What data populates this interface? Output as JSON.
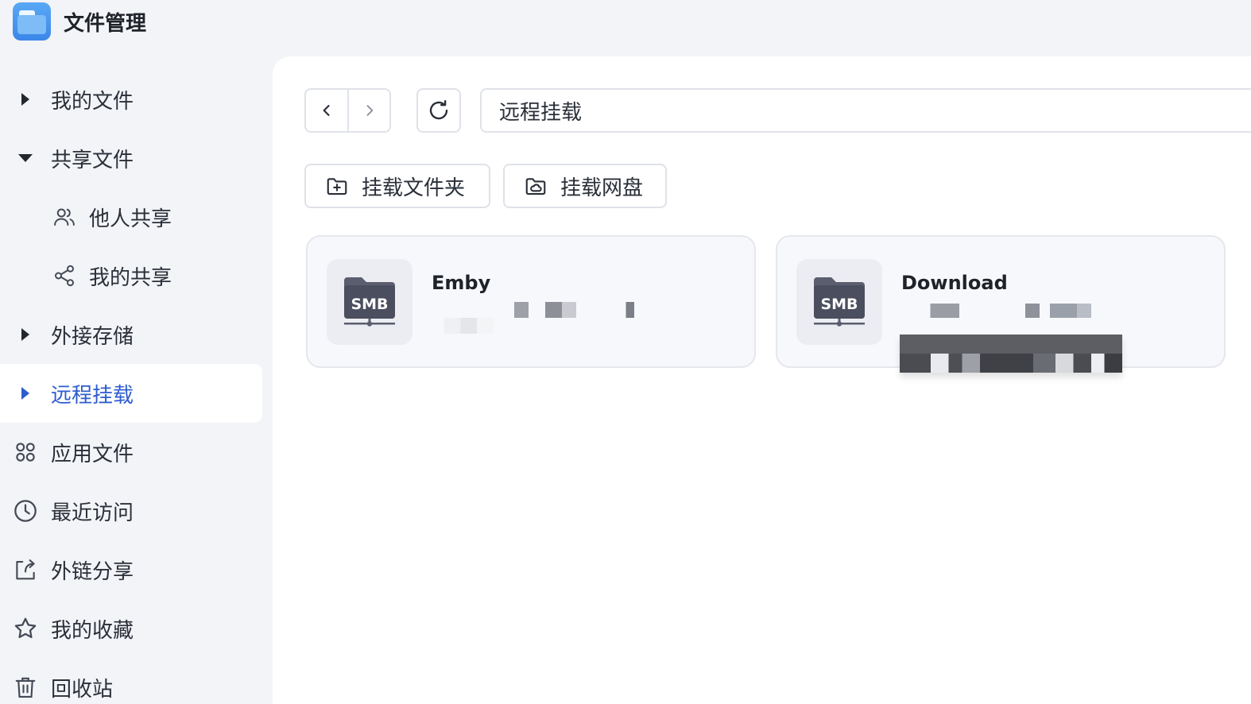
{
  "app": {
    "title": "文件管理"
  },
  "sidebar": {
    "items": [
      {
        "label": "我的文件"
      },
      {
        "label": "共享文件"
      },
      {
        "label": "他人共享"
      },
      {
        "label": "我的共享"
      },
      {
        "label": "外接存储"
      },
      {
        "label": "远程挂载",
        "active": true
      },
      {
        "label": "应用文件"
      },
      {
        "label": "最近访问"
      },
      {
        "label": "外链分享"
      },
      {
        "label": "我的收藏"
      },
      {
        "label": "回收站"
      }
    ]
  },
  "toolbar": {
    "path": "远程挂载",
    "mount_folder_label": "挂载文件夹",
    "mount_cloud_label": "挂载网盘"
  },
  "mounts": [
    {
      "name": "Emby",
      "type": "SMB"
    },
    {
      "name": "Download",
      "type": "SMB"
    }
  ],
  "colors": {
    "accent": "#2e5ccf",
    "sidebar_bg": "#f3f4f8",
    "card_bg": "#f7f8fb"
  }
}
